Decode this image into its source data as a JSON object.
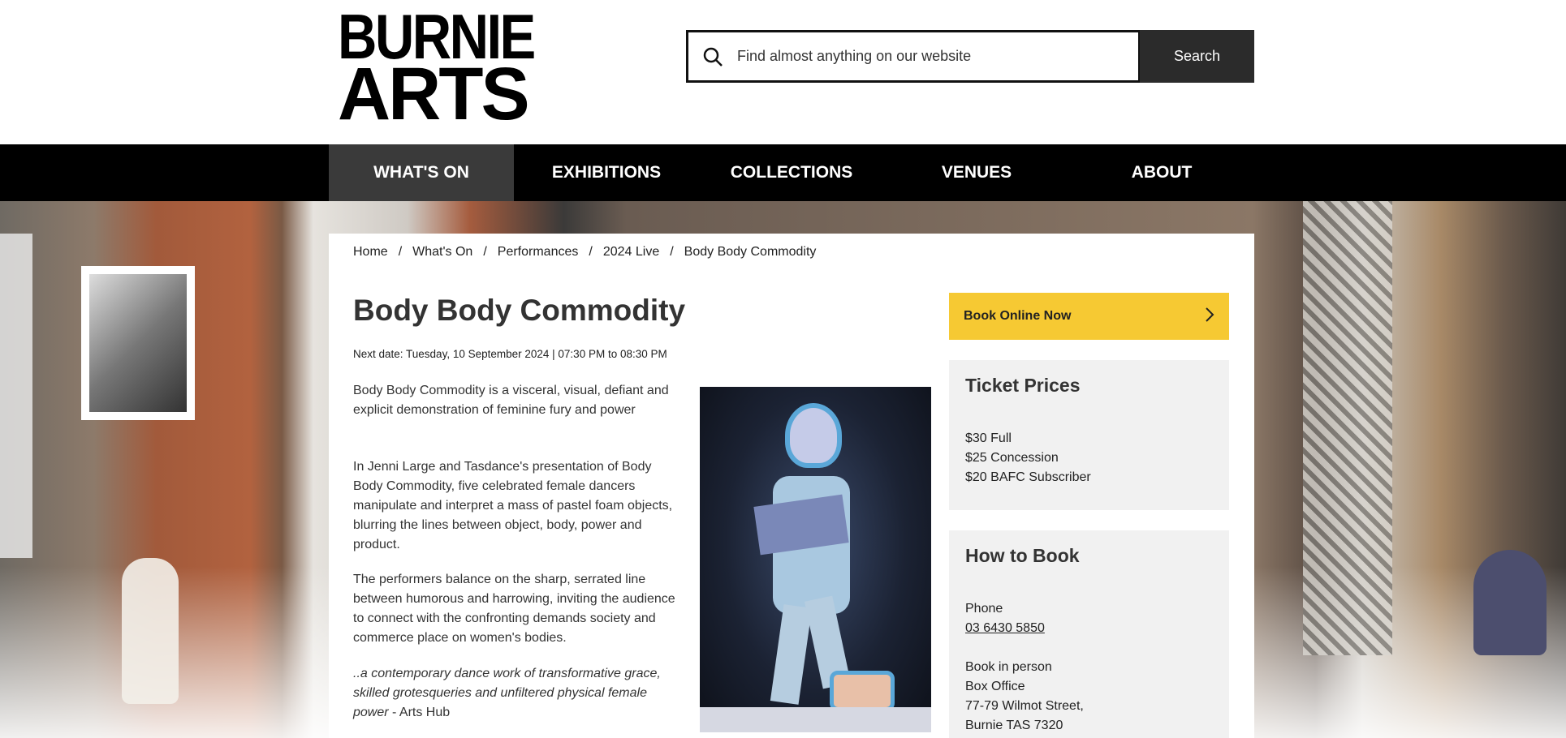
{
  "logo": {
    "line1": "BURNIE",
    "line2": "ARTS"
  },
  "search": {
    "placeholder": "Find almost anything on our website",
    "button_label": "Search",
    "icon": "search-icon"
  },
  "nav": {
    "items": [
      {
        "label": "WHAT'S ON",
        "active": true
      },
      {
        "label": "EXHIBITIONS",
        "active": false
      },
      {
        "label": "COLLECTIONS",
        "active": false
      },
      {
        "label": "VENUES",
        "active": false
      },
      {
        "label": "ABOUT",
        "active": false
      }
    ]
  },
  "breadcrumb": {
    "items": [
      "Home",
      "What's On",
      "Performances",
      "2024 Live",
      "Body Body Commodity"
    ],
    "separator": "/"
  },
  "page": {
    "title": "Body Body Commodity",
    "next_date": "Next date: Tuesday, 10 September 2024 | 07:30 PM to 08:30 PM",
    "paragraphs": [
      "Body Body Commodity is a visceral, visual, defiant and explicit demonstration of feminine fury and power",
      "In Jenni Large and Tasdance's presentation of Body Body Commodity, five celebrated female dancers manipulate and interpret a mass of pastel foam objects, blurring the lines between object, body, power and product.",
      "The performers balance on the sharp, serrated line between humorous and harrowing, inviting the audience to connect with the confronting demands society and commerce place on women's bodies."
    ],
    "quote": "..a contemporary dance work of transformative grace, skilled grotesqueries and unfiltered physical female power",
    "quote_source": " - Arts Hub"
  },
  "sidebar": {
    "book_button": "Book Online Now",
    "ticket_prices": {
      "heading": "Ticket Prices",
      "items": [
        "$30 Full",
        "$25 Concession",
        "$20 BAFC Subscriber"
      ]
    },
    "how_to_book": {
      "heading": "How to Book",
      "phone_label": "Phone",
      "phone_number": "03 6430 5850",
      "in_person_label": "Book in person",
      "address_lines": [
        "Box Office",
        "77-79 Wilmot Street,",
        "Burnie TAS 7320"
      ]
    }
  },
  "colors": {
    "accent": "#f6c933",
    "nav_bg": "#000000",
    "nav_active": "#3a3a3a",
    "panel_bg": "#f1f1f1"
  }
}
